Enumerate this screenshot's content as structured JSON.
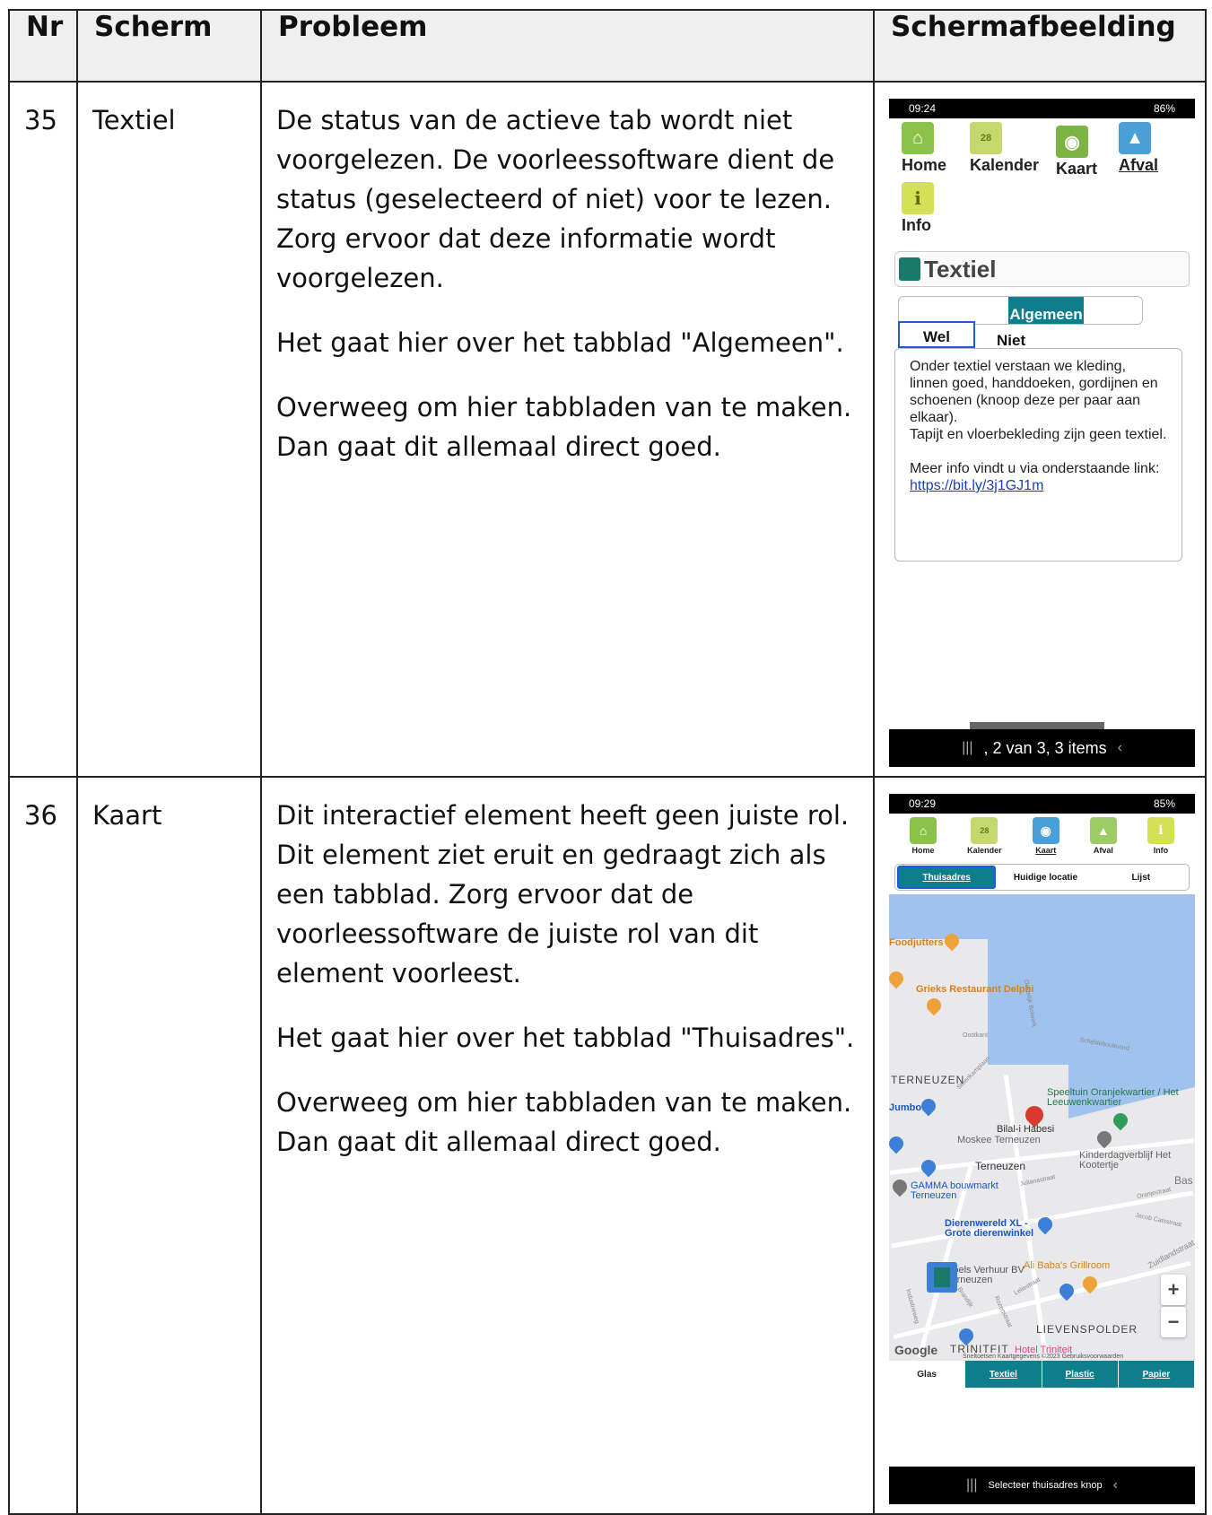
{
  "table": {
    "headers": {
      "nr": "Nr",
      "scherm": "Scherm",
      "probleem": "Probleem",
      "schermafbeelding": "Schermafbeelding"
    },
    "rows": [
      {
        "nr": "35",
        "scherm": "Textiel",
        "probleem": [
          "De status van de actieve tab wordt niet voorgelezen. De voorleessoftware dient de status (geselecteerd of niet) voor te lezen. Zorg ervoor dat deze informatie wordt voorgelezen.",
          "Het gaat hier over het tabblad \"Algemeen\".",
          "Overweeg om hier tabbladen van te maken. Dan gaat dit allemaal direct goed."
        ]
      },
      {
        "nr": "36",
        "scherm": "Kaart",
        "probleem": [
          "Dit interactief element heeft geen juiste rol. Dit element ziet eruit en gedraagt zich als een tabblad. Zorg ervoor dat de voorleessoftware de juiste rol van dit element voorleest.",
          "Het gaat hier over het tabblad \"Thuisadres\".",
          "Overweeg om hier tabbladen van te maken. Dan gaat dit allemaal direct goed."
        ]
      }
    ]
  },
  "screenshot1": {
    "status_time": "09:24",
    "status_battery": "86%",
    "nav": [
      "Home",
      "Kalender",
      "Kaart",
      "Afval",
      "Info"
    ],
    "nav_active": "Afval",
    "calendar_number": "28",
    "title": "Textiel",
    "tab_label": "Algemeen",
    "wel": "Wel",
    "niet": "Niet",
    "info_lines": [
      "Onder textiel verstaan we kleding, linnen goed, handdoeken, gordijnen en schoenen (knoop deze per paar aan elkaar).",
      "Tapijt en vloerbekleding zijn geen textiel."
    ],
    "more_info": "Meer info vindt u via onderstaande link:",
    "link": "https://bit.ly/3j1GJ1m",
    "talkback": ", 2 van 3, 3 items"
  },
  "screenshot2": {
    "status_time": "09:29",
    "status_battery": "85%",
    "nav": [
      "Home",
      "Kalender",
      "Kaart",
      "Afval",
      "Info"
    ],
    "nav_active": "Kaart",
    "tabs": [
      "Thuisadres",
      "Huidige locatie",
      "Lijst"
    ],
    "map_labels": {
      "foodjutters": "Foodjutters",
      "grieks": "Grieks Restaurant Delphi",
      "oostkant": "Oostkant",
      "oostelijk": "Oostelijk Bolwerk",
      "scheldeboulevard": "Scheldeboulevard",
      "steenkamplaan": "Steenkamplaan",
      "terneuzen_caps": "TERNEUZEN",
      "speeltuin": "Speeltuin Oranjekwartier / Het Leeuwenkwartier",
      "jumbo": "Jumbo",
      "bilal": "Bilal-i Habesi",
      "moskee": "Moskee Terneuzen",
      "kinderdag": "Kinderdagverblijf Het Kootertje",
      "terneuzen": "Terneuzen",
      "gamma": "GAMMA bouwmarkt Terneuzen",
      "julianastraat": "Julianastraat",
      "bas": "Bas",
      "oranjestraat": "Oranjestraat",
      "dierenwereld": "Dierenwereld XL - Grote dierenwinkel",
      "jacob": "Jacob Catsstraat",
      "zuidlandstraat": "Zuidlandstraat",
      "alibaba": "Ali Baba's Grillroom",
      "boels": "Boels Verhuur BV Terneuzen",
      "industrieweg": "Industrieweg",
      "brandijk": "Brandijk",
      "rozenstraat": "Rozenstraat",
      "leliestraat": "Leliestraat",
      "lievenspolder": "LIEVENSPOLDER",
      "trinitfit": "TRINITFIT",
      "hotel": "Hotel Triniteit",
      "google": "Google",
      "footer": "Sneltoetsen   Kaartgegevens ©2023   Gebruiksvoorwaarden"
    },
    "bottom_tabs": [
      "Glas",
      "Textiel",
      "Plastic",
      "Papier"
    ],
    "talkback": "Selecteer thuisadres knop"
  }
}
